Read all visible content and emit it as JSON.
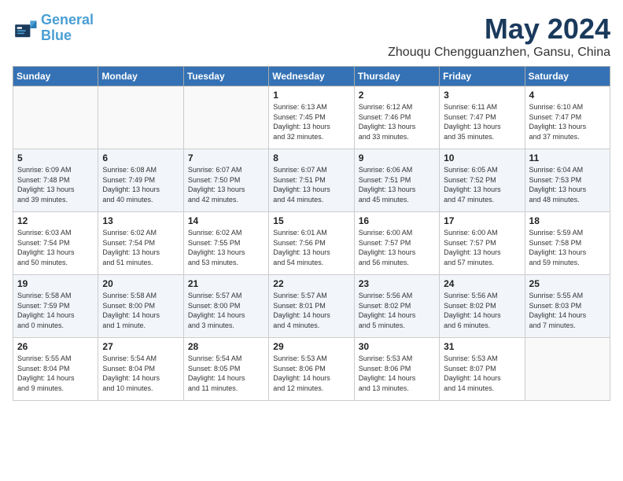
{
  "header": {
    "logo_line1": "General",
    "logo_line2": "Blue",
    "month_title": "May 2024",
    "subtitle": "Zhouqu Chengguanzhen, Gansu, China"
  },
  "days_of_week": [
    "Sunday",
    "Monday",
    "Tuesday",
    "Wednesday",
    "Thursday",
    "Friday",
    "Saturday"
  ],
  "weeks": [
    [
      {
        "day": "",
        "info": ""
      },
      {
        "day": "",
        "info": ""
      },
      {
        "day": "",
        "info": ""
      },
      {
        "day": "1",
        "info": "Sunrise: 6:13 AM\nSunset: 7:45 PM\nDaylight: 13 hours\nand 32 minutes."
      },
      {
        "day": "2",
        "info": "Sunrise: 6:12 AM\nSunset: 7:46 PM\nDaylight: 13 hours\nand 33 minutes."
      },
      {
        "day": "3",
        "info": "Sunrise: 6:11 AM\nSunset: 7:47 PM\nDaylight: 13 hours\nand 35 minutes."
      },
      {
        "day": "4",
        "info": "Sunrise: 6:10 AM\nSunset: 7:47 PM\nDaylight: 13 hours\nand 37 minutes."
      }
    ],
    [
      {
        "day": "5",
        "info": "Sunrise: 6:09 AM\nSunset: 7:48 PM\nDaylight: 13 hours\nand 39 minutes."
      },
      {
        "day": "6",
        "info": "Sunrise: 6:08 AM\nSunset: 7:49 PM\nDaylight: 13 hours\nand 40 minutes."
      },
      {
        "day": "7",
        "info": "Sunrise: 6:07 AM\nSunset: 7:50 PM\nDaylight: 13 hours\nand 42 minutes."
      },
      {
        "day": "8",
        "info": "Sunrise: 6:07 AM\nSunset: 7:51 PM\nDaylight: 13 hours\nand 44 minutes."
      },
      {
        "day": "9",
        "info": "Sunrise: 6:06 AM\nSunset: 7:51 PM\nDaylight: 13 hours\nand 45 minutes."
      },
      {
        "day": "10",
        "info": "Sunrise: 6:05 AM\nSunset: 7:52 PM\nDaylight: 13 hours\nand 47 minutes."
      },
      {
        "day": "11",
        "info": "Sunrise: 6:04 AM\nSunset: 7:53 PM\nDaylight: 13 hours\nand 48 minutes."
      }
    ],
    [
      {
        "day": "12",
        "info": "Sunrise: 6:03 AM\nSunset: 7:54 PM\nDaylight: 13 hours\nand 50 minutes."
      },
      {
        "day": "13",
        "info": "Sunrise: 6:02 AM\nSunset: 7:54 PM\nDaylight: 13 hours\nand 51 minutes."
      },
      {
        "day": "14",
        "info": "Sunrise: 6:02 AM\nSunset: 7:55 PM\nDaylight: 13 hours\nand 53 minutes."
      },
      {
        "day": "15",
        "info": "Sunrise: 6:01 AM\nSunset: 7:56 PM\nDaylight: 13 hours\nand 54 minutes."
      },
      {
        "day": "16",
        "info": "Sunrise: 6:00 AM\nSunset: 7:57 PM\nDaylight: 13 hours\nand 56 minutes."
      },
      {
        "day": "17",
        "info": "Sunrise: 6:00 AM\nSunset: 7:57 PM\nDaylight: 13 hours\nand 57 minutes."
      },
      {
        "day": "18",
        "info": "Sunrise: 5:59 AM\nSunset: 7:58 PM\nDaylight: 13 hours\nand 59 minutes."
      }
    ],
    [
      {
        "day": "19",
        "info": "Sunrise: 5:58 AM\nSunset: 7:59 PM\nDaylight: 14 hours\nand 0 minutes."
      },
      {
        "day": "20",
        "info": "Sunrise: 5:58 AM\nSunset: 8:00 PM\nDaylight: 14 hours\nand 1 minute."
      },
      {
        "day": "21",
        "info": "Sunrise: 5:57 AM\nSunset: 8:00 PM\nDaylight: 14 hours\nand 3 minutes."
      },
      {
        "day": "22",
        "info": "Sunrise: 5:57 AM\nSunset: 8:01 PM\nDaylight: 14 hours\nand 4 minutes."
      },
      {
        "day": "23",
        "info": "Sunrise: 5:56 AM\nSunset: 8:02 PM\nDaylight: 14 hours\nand 5 minutes."
      },
      {
        "day": "24",
        "info": "Sunrise: 5:56 AM\nSunset: 8:02 PM\nDaylight: 14 hours\nand 6 minutes."
      },
      {
        "day": "25",
        "info": "Sunrise: 5:55 AM\nSunset: 8:03 PM\nDaylight: 14 hours\nand 7 minutes."
      }
    ],
    [
      {
        "day": "26",
        "info": "Sunrise: 5:55 AM\nSunset: 8:04 PM\nDaylight: 14 hours\nand 9 minutes."
      },
      {
        "day": "27",
        "info": "Sunrise: 5:54 AM\nSunset: 8:04 PM\nDaylight: 14 hours\nand 10 minutes."
      },
      {
        "day": "28",
        "info": "Sunrise: 5:54 AM\nSunset: 8:05 PM\nDaylight: 14 hours\nand 11 minutes."
      },
      {
        "day": "29",
        "info": "Sunrise: 5:53 AM\nSunset: 8:06 PM\nDaylight: 14 hours\nand 12 minutes."
      },
      {
        "day": "30",
        "info": "Sunrise: 5:53 AM\nSunset: 8:06 PM\nDaylight: 14 hours\nand 13 minutes."
      },
      {
        "day": "31",
        "info": "Sunrise: 5:53 AM\nSunset: 8:07 PM\nDaylight: 14 hours\nand 14 minutes."
      },
      {
        "day": "",
        "info": ""
      }
    ]
  ]
}
